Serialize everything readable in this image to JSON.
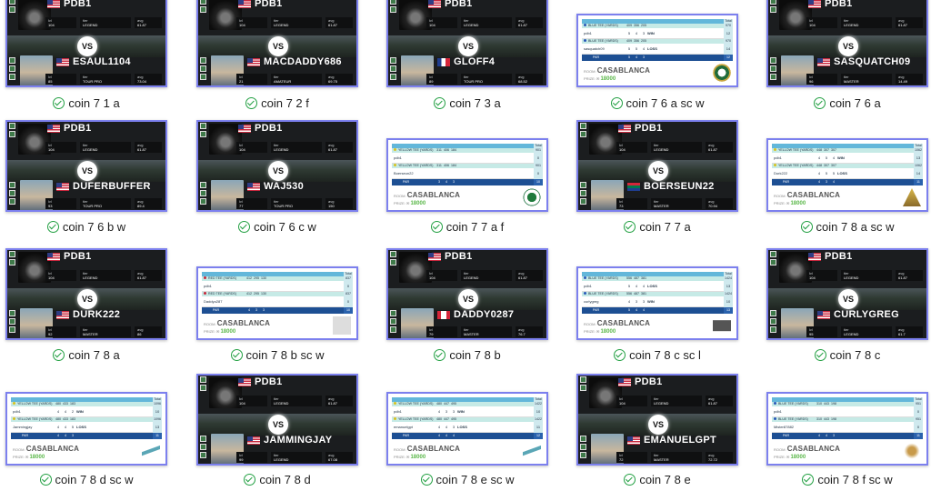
{
  "accent": "#7c80ee",
  "status_icon": "check-circle-icon",
  "status_color": "#23a043",
  "vs_label": "VS",
  "player": {
    "name": "PDB1",
    "flag": "us",
    "lvl_label": "lvl",
    "tier_label": "tier",
    "avg_label": "avg",
    "lvl": "104",
    "tier": "LEGEND",
    "avg": "61.87"
  },
  "scorecard_labels": {
    "room_label": "ROOM:",
    "room": "CASABLANCA",
    "prize_label": "PRIZE:",
    "prize": "18000",
    "total_label": "Total",
    "par_label": "PAR",
    "coins_label": "Coins Earned"
  },
  "files": [
    {
      "label": "coin 7 1 a",
      "type": "vs",
      "opponent": {
        "name": "ESAUL1104",
        "flag": "us",
        "lvl": "85",
        "tier": "TOUR PRO",
        "avg": "73.04"
      }
    },
    {
      "label": "coin 7 2 f",
      "type": "vs",
      "opponent": {
        "name": "MACDADDY686",
        "flag": "us",
        "lvl": "21",
        "tier": "AMATEUR",
        "avg": "69.75"
      }
    },
    {
      "label": "coin 7 3 a",
      "type": "vs",
      "opponent": {
        "name": "GLOFF4",
        "flag": "fr",
        "lvl": "89",
        "tier": "TOUR PRO",
        "avg": "68.52"
      }
    },
    {
      "label": "coin 7 6 a sc w",
      "type": "score",
      "tee": "BLUE TEE (YARDS)",
      "tee_color": "#2a58b8",
      "yards": [
        "409",
        "356",
        "205"
      ],
      "yards_total": "970",
      "p1": {
        "name": "pdb1",
        "scores": [
          "5",
          "4",
          "3"
        ],
        "result": "WIN",
        "total": "12"
      },
      "p2": {
        "name": "sasquatch09",
        "scores": [
          "5",
          "5",
          "4"
        ],
        "result": "LOSS",
        "total": "14"
      },
      "par": [
        "5",
        "4",
        "3"
      ],
      "par_total": "12",
      "logo": "casablanca-cc-logo"
    },
    {
      "label": "coin 7 6 a",
      "type": "vs",
      "opponent": {
        "name": "SASQUATCH09",
        "flag": "us",
        "lvl": "96",
        "tier": "MASTER",
        "avg": "14.49"
      }
    },
    {
      "label": "coin 7 6 b w",
      "type": "vs",
      "opponent": {
        "name": "DUFERBUFFER",
        "flag": "us",
        "lvl": "93",
        "tier": "TOUR PRO",
        "avg": "89.4"
      }
    },
    {
      "label": "coin 7 6 c w",
      "type": "vs",
      "opponent": {
        "name": "WAJ530",
        "flag": "us",
        "lvl": "77",
        "tier": "TOUR PRO",
        "avg": "150"
      }
    },
    {
      "label": "coin 7 7 a f",
      "type": "score",
      "tee": "YELLOW TEE (YARDS)",
      "tee_color": "#d8c21e",
      "yards": [
        "311",
        "406",
        "184"
      ],
      "yards_total": "901",
      "p1": {
        "name": "pdb1",
        "scores": [
          "",
          "",
          ""
        ],
        "result": "",
        "total": "0"
      },
      "p2": {
        "name": "Boerseun22",
        "scores": [
          "",
          "",
          ""
        ],
        "result": "",
        "total": "0"
      },
      "par": [
        "3",
        "4",
        "3"
      ],
      "par_total": "10",
      "logo": "golf-club-logo"
    },
    {
      "label": "coin 7 7 a",
      "type": "vs",
      "opponent": {
        "name": "BOERSEUN22",
        "flag": "za",
        "lvl": "73",
        "tier": "MASTER",
        "avg": "70.94"
      }
    },
    {
      "label": "coin 7 8 a sc w",
      "type": "score",
      "tee": "YELLOW TEE (YARDS)",
      "tee_color": "#d8c21e",
      "yards": [
        "448",
        "307",
        "307"
      ],
      "yards_total": "1062",
      "p1": {
        "name": "pdb1",
        "scores": [
          "4",
          "5",
          "4"
        ],
        "result": "WIN",
        "total": "13"
      },
      "p2": {
        "name": "Durk222",
        "scores": [
          "4",
          "5",
          "5"
        ],
        "result": "LOSS",
        "total": "14"
      },
      "par": [
        "4",
        "3",
        "4"
      ],
      "par_total": "11",
      "logo": "trophy-logo"
    },
    {
      "label": "coin 7 8 a",
      "type": "vs",
      "opponent": {
        "name": "DURK222",
        "flag": "us",
        "lvl": "92",
        "tier": "MASTER",
        "avg": "86"
      }
    },
    {
      "label": "coin 7 8 b sc w",
      "type": "score",
      "tee": "RED TEE (YARDS)",
      "tee_color": "#c8283a",
      "yards": [
        "412",
        "295",
        "130"
      ],
      "yards_total": "837",
      "p1": {
        "name": "pdb1",
        "scores": [
          "",
          "",
          ""
        ],
        "result": "",
        "total": "0"
      },
      "p2": {
        "name": "Daddyo287",
        "scores": [
          "",
          "",
          ""
        ],
        "result": "",
        "total": "0"
      },
      "par": [
        "4",
        "3",
        "3"
      ],
      "par_total": "10",
      "logo": "blank-logo"
    },
    {
      "label": "coin 7 8 b",
      "type": "vs",
      "opponent": {
        "name": "DADDY0287",
        "flag": "ca",
        "lvl": "79",
        "tier": "MASTER",
        "avg": "76.7"
      }
    },
    {
      "label": "coin 7 8 c sc l",
      "type": "score",
      "tee": "BLUE TEE (YARDS)",
      "tee_color": "#2a58b8",
      "yards": [
        "556",
        "487",
        "381"
      ],
      "yards_total": "1424",
      "p1": {
        "name": "pdb1",
        "scores": [
          "5",
          "4",
          "4"
        ],
        "result": "LOSS",
        "total": "13"
      },
      "p2": {
        "name": "curlygreg",
        "scores": [
          "4",
          "3",
          "3"
        ],
        "result": "WIN",
        "total": "10"
      },
      "par": [
        "5",
        "4",
        "4"
      ],
      "par_total": "13",
      "logo": "golfer-statue-logo"
    },
    {
      "label": "coin 7 8 c",
      "type": "vs",
      "opponent": {
        "name": "CURLYGREG",
        "flag": "us",
        "lvl": "95",
        "tier": "LEGEND",
        "avg": "61.7"
      }
    },
    {
      "label": "coin 7 8 d sc w",
      "type": "score",
      "tee": "YELLOW TEE (YARDS)",
      "tee_color": "#d8c21e",
      "yards": [
        "480",
        "433",
        "183"
      ],
      "yards_total": "1096",
      "p1": {
        "name": "pdb1",
        "scores": [
          "4",
          "4",
          "2"
        ],
        "result": "WIN",
        "total": "10"
      },
      "p2": {
        "name": "Jammingjay",
        "scores": [
          "4",
          "4",
          "5"
        ],
        "result": "LOSS",
        "total": "13"
      },
      "par": [
        "4",
        "4",
        "3"
      ],
      "par_total": "11",
      "logo": "chandlers-bay-logo"
    },
    {
      "label": "coin 7 8 d",
      "type": "vs",
      "opponent": {
        "name": "JAMMINGJAY",
        "flag": "us",
        "lvl": "99",
        "tier": "LEGEND",
        "avg": "67.08"
      }
    },
    {
      "label": "coin 7 8 e sc w",
      "type": "score",
      "tee": "YELLOW TEE (YARDS)",
      "tee_color": "#d8c21e",
      "yards": [
        "480",
        "447",
        "495"
      ],
      "yards_total": "1422",
      "p1": {
        "name": "pdb1",
        "scores": [
          "4",
          "3",
          "3"
        ],
        "result": "WIN",
        "total": "10"
      },
      "p2": {
        "name": "emanuelgpt",
        "scores": [
          "4",
          "4",
          "3"
        ],
        "result": "LOSS",
        "total": "11"
      },
      "par": [
        "4",
        "4",
        "4"
      ],
      "par_total": "12",
      "logo": "chandlers-bay-logo"
    },
    {
      "label": "coin 7 8 e",
      "type": "vs",
      "opponent": {
        "name": "EMANUELGPT",
        "flag": "us",
        "lvl": "72",
        "tier": "MASTER",
        "avg": "72.72"
      }
    },
    {
      "label": "coin 7 8 f sc w",
      "type": "score",
      "tee": "BLUE TEE (YARDS)",
      "tee_color": "#2a58b8",
      "yards": [
        "310",
        "443",
        "198"
      ],
      "yards_total": "951",
      "p1": {
        "name": "pdb1",
        "scores": [
          "",
          "",
          ""
        ],
        "result": "",
        "total": "0"
      },
      "p2": {
        "name": "Mister87882",
        "scores": [
          "",
          "",
          ""
        ],
        "result": "",
        "total": "0"
      },
      "par": [
        "4",
        "4",
        "3"
      ],
      "par_total": "11",
      "logo": "mascot-logo"
    }
  ]
}
